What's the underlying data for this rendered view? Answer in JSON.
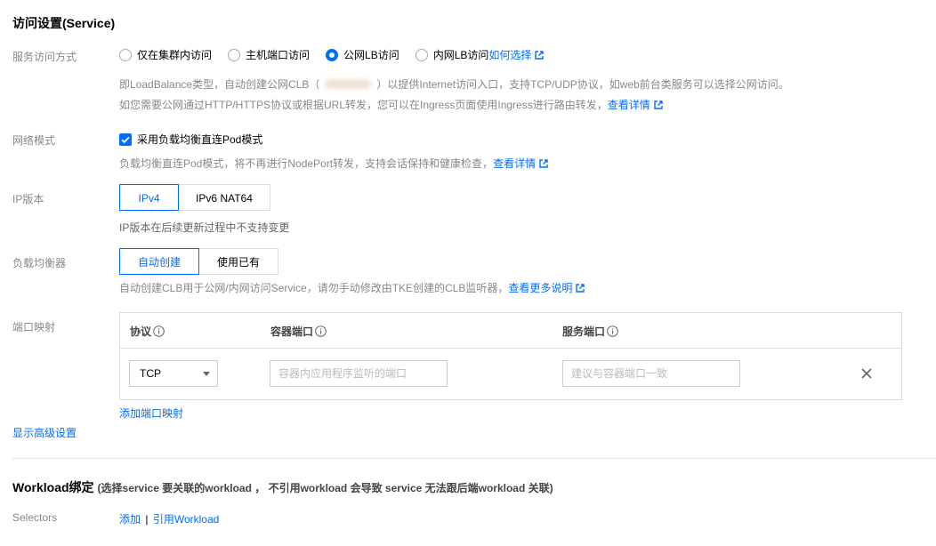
{
  "section_title": "访问设置(Service)",
  "service_access": {
    "label": "服务访问方式",
    "options": [
      "仅在集群内访问",
      "主机端口访问",
      "公网LB访问",
      "内网LB访问"
    ],
    "selected": "公网LB访问",
    "how_to_choose_link": "如何选择",
    "desc_line1_part1": "即LoadBalance类型，自动创建公网CLB（",
    "desc_line1_part2": "）以提供Internet访问入口，支持TCP/UDP协议，如web前台类服务可以选择公网访问。",
    "desc_line2": "如您需要公网通过HTTP/HTTPS协议或根据URL转发，您可以在Ingress页面使用Ingress进行路由转发，",
    "desc_line2_link": "查看详情"
  },
  "network_mode": {
    "label": "网络模式",
    "checkbox_label": "采用负载均衡直连Pod模式",
    "checked": true,
    "desc": "负载均衡直连Pod模式，将不再进行NodePort转发，支持会话保持和健康检查，",
    "desc_link": "查看详情"
  },
  "ip_version": {
    "label": "IP版本",
    "options": [
      "IPv4",
      "IPv6 NAT64"
    ],
    "selected": "IPv4",
    "desc": "IP版本在后续更新过程中不支持变更"
  },
  "load_balancer": {
    "label": "负载均衡器",
    "options": [
      "自动创建",
      "使用已有"
    ],
    "selected": "自动创建",
    "desc": "自动创建CLB用于公网/内网访问Service，请勿手动修改由TKE创建的CLB监听器，",
    "desc_link": "查看更多说明"
  },
  "port_mapping": {
    "label": "端口映射",
    "columns": [
      "协议",
      "容器端口",
      "服务端口"
    ],
    "protocol_value": "TCP",
    "container_port_placeholder": "容器内应用程序监听的端口",
    "service_port_placeholder": "建议与容器端口一致",
    "add_link": "添加端口映射"
  },
  "advanced_link": "显示高级设置",
  "workload": {
    "title": "Workload绑定",
    "subtitle": "(选择service 要关联的workload ， 不引用workload 会导致 service 无法跟后端workload 关联)",
    "selectors_label": "Selectors",
    "add_link": "添加",
    "separator": "|",
    "ref_link": "引用Workload"
  },
  "colors": {
    "accent": "#006eff",
    "hint": "#888888",
    "border": "#dddddd"
  },
  "icons": [
    "external-link-icon",
    "info-icon",
    "close-icon",
    "checkmark-icon",
    "caret-down-icon"
  ]
}
